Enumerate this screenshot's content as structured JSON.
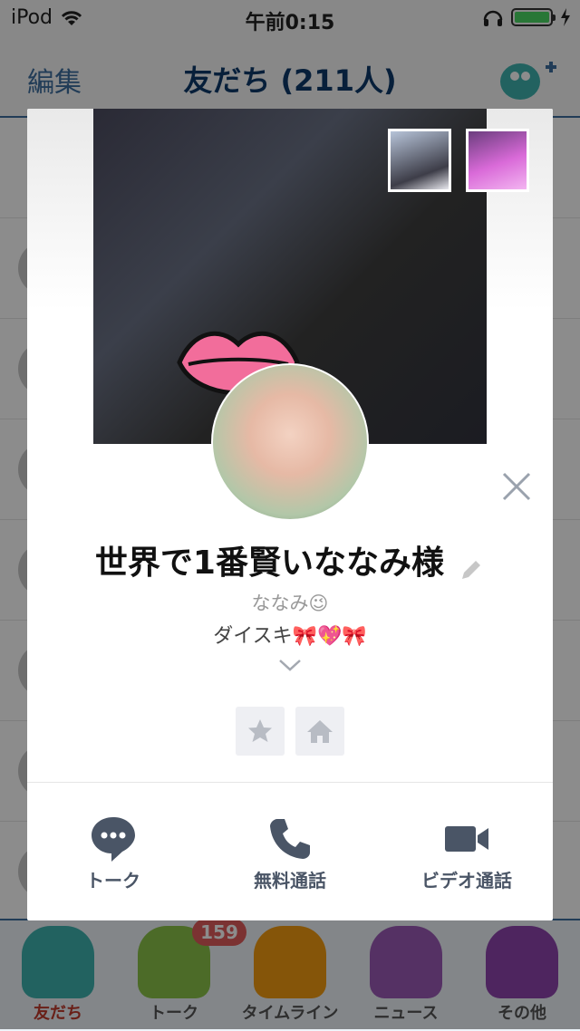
{
  "status_bar": {
    "carrier": "iPod",
    "time": "午前0:15",
    "battery_color": "#4cd964"
  },
  "navbar": {
    "edit_label": "編集",
    "title": "友だち (211人)"
  },
  "tabbar": {
    "badge": "159",
    "items": [
      {
        "label": "友だち",
        "icon": "friends-mascot-icon",
        "active": true
      },
      {
        "label": "トーク",
        "icon": "talk-mascot-icon"
      },
      {
        "label": "タイムライン",
        "icon": "timeline-mascot-icon"
      },
      {
        "label": "ニュース",
        "icon": "news-mascot-icon"
      },
      {
        "label": "その他",
        "icon": "more-mascot-icon"
      }
    ]
  },
  "profile": {
    "name": "世界で1番賢いななみ様",
    "subname": "ななみ😉",
    "status_message": "ダイスキ🎀💖🎀",
    "buttons": {
      "favorite_icon": "star-icon",
      "home_icon": "home-icon"
    },
    "actions": [
      {
        "label": "トーク",
        "icon": "chat-bubble-icon"
      },
      {
        "label": "無料通話",
        "icon": "phone-icon"
      },
      {
        "label": "ビデオ通話",
        "icon": "video-camera-icon"
      }
    ]
  },
  "colors": {
    "accent": "#3c6d9e",
    "action_icon": "#4a5566",
    "dim": "rgba(0,0,0,0.45)"
  }
}
